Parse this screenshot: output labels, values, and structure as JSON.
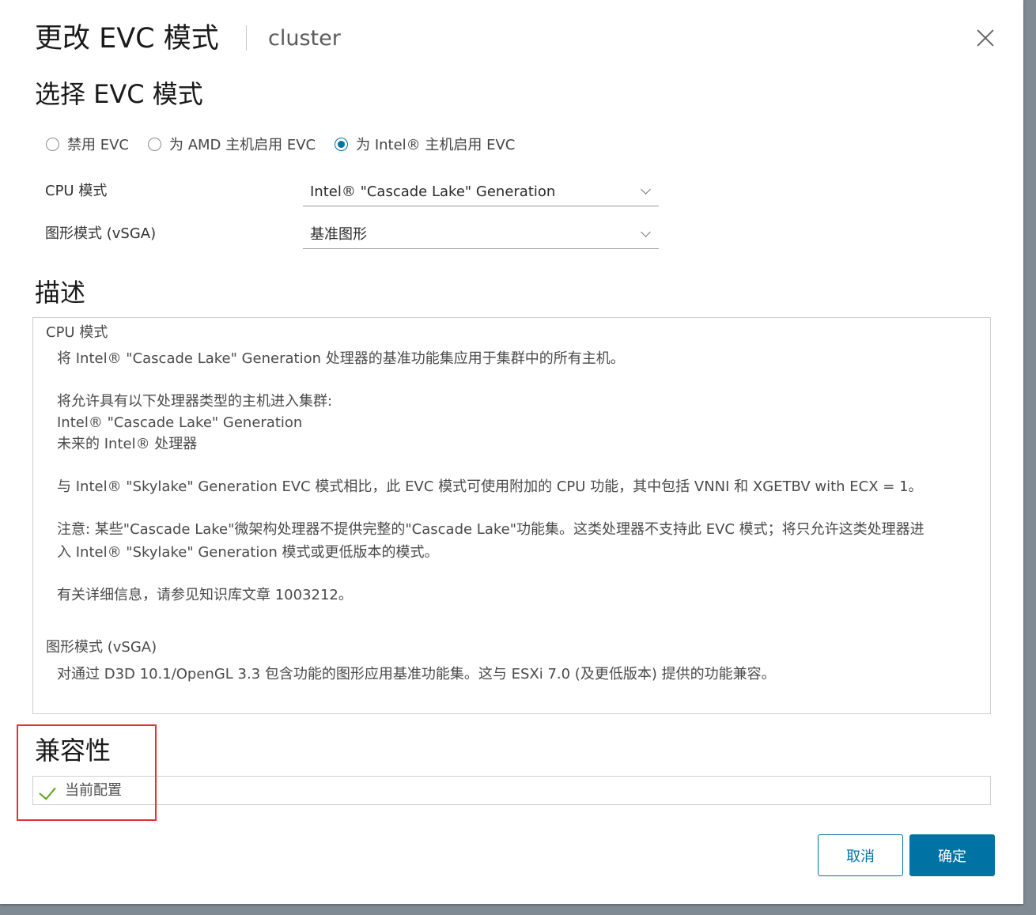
{
  "dialog": {
    "title": "更改 EVC 模式",
    "subtitle": "cluster"
  },
  "select_section": {
    "heading": "选择 EVC 模式",
    "radios": [
      {
        "label": "禁用 EVC",
        "checked": false
      },
      {
        "label": "为 AMD 主机启用 EVC",
        "checked": false
      },
      {
        "label": "为 Intel® 主机启用 EVC",
        "checked": true
      }
    ],
    "cpu_mode_label": "CPU 模式",
    "cpu_mode_value": "Intel® \"Cascade Lake\" Generation",
    "graphics_mode_label": "图形模式 (vSGA)",
    "graphics_mode_value": "基准图形"
  },
  "description": {
    "heading": "描述",
    "cpu_section_title": "CPU 模式",
    "cpu_line1": "将 Intel® \"Cascade Lake\" Generation 处理器的基准功能集应用于集群中的所有主机。",
    "cpu_line2": "将允许具有以下处理器类型的主机进入集群:",
    "cpu_line3": "Intel® \"Cascade Lake\" Generation",
    "cpu_line4": "未来的 Intel® 处理器",
    "cpu_line5": "与 Intel® \"Skylake\" Generation EVC 模式相比，此 EVC 模式可使用附加的 CPU 功能，其中包括 VNNI 和 XGETBV with ECX = 1。",
    "cpu_line6": "注意: 某些\"Cascade Lake\"微架构处理器不提供完整的\"Cascade Lake\"功能集。这类处理器不支持此 EVC 模式；将只允许这类处理器进",
    "cpu_line7": "入 Intel® \"Skylake\" Generation 模式或更低版本的模式。",
    "cpu_line8": "有关详细信息，请参见知识库文章 1003212。",
    "graphics_section_title": "图形模式 (vSGA)",
    "graphics_line1": "对通过 D3D 10.1/OpenGL 3.3 包含功能的图形应用基准功能集。这与 ESXi 7.0 (及更低版本) 提供的功能兼容。"
  },
  "compatibility": {
    "heading": "兼容性",
    "status_label": "当前配置",
    "status_icon": "check-icon",
    "status_color": "#5aa220"
  },
  "buttons": {
    "cancel": "取消",
    "ok": "确定"
  },
  "colors": {
    "accent": "#0072a3",
    "highlight": "#e0333a"
  }
}
